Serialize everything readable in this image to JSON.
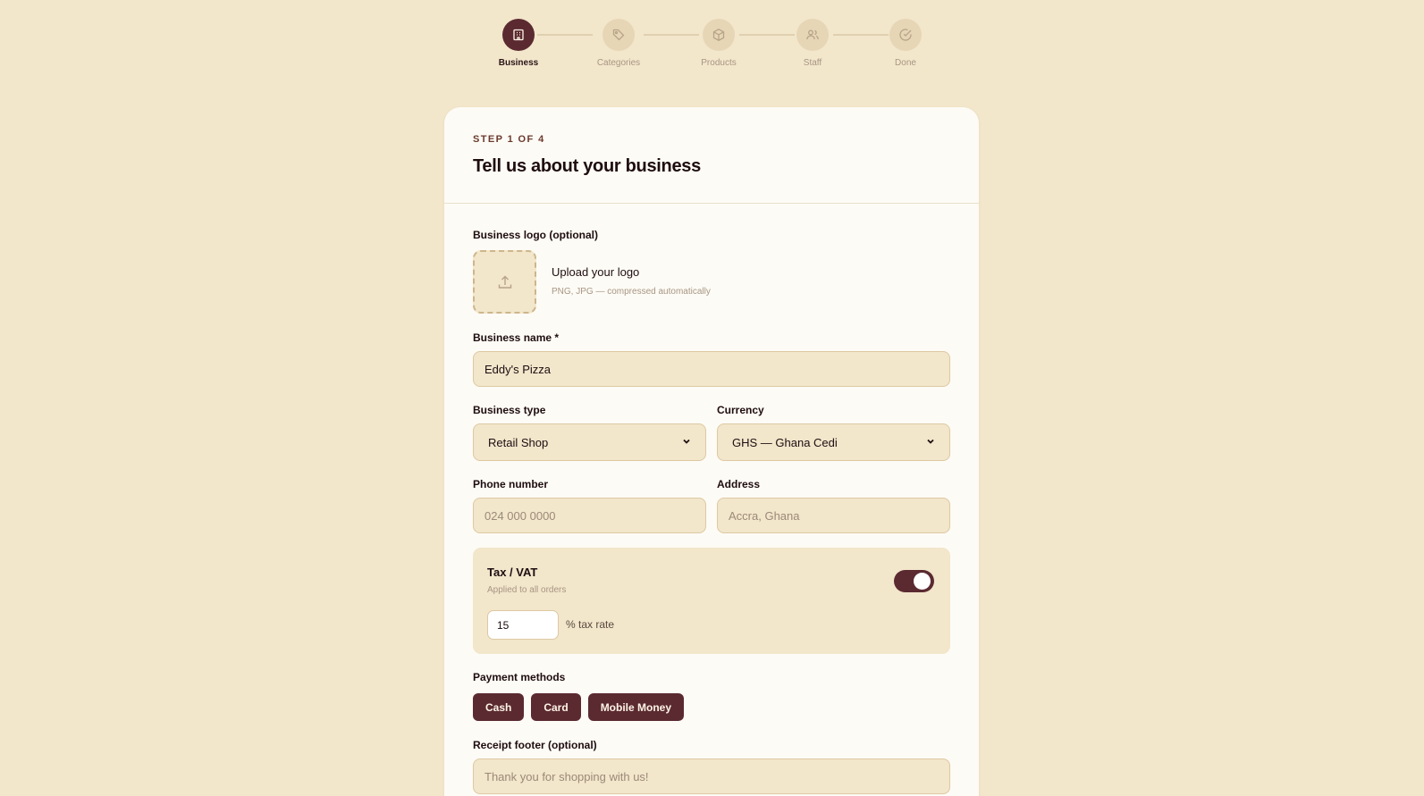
{
  "stepper": {
    "steps": [
      {
        "label": "Business",
        "icon": "building-icon",
        "state": "active"
      },
      {
        "label": "Categories",
        "icon": "tag-icon",
        "state": "pending"
      },
      {
        "label": "Products",
        "icon": "box-icon",
        "state": "pending"
      },
      {
        "label": "Staff",
        "icon": "users-icon",
        "state": "pending"
      },
      {
        "label": "Done",
        "icon": "check-circle-icon",
        "state": "pending"
      }
    ]
  },
  "card": {
    "step_indicator": "STEP 1 OF 4",
    "title": "Tell us about your business"
  },
  "logo": {
    "label": "Business logo (optional)",
    "upload_title": "Upload your logo",
    "upload_hint": "PNG, JPG — compressed automatically"
  },
  "business_name": {
    "label": "Business name *",
    "value": "Eddy's Pizza"
  },
  "business_type": {
    "label": "Business type",
    "selected": "Retail Shop"
  },
  "currency": {
    "label": "Currency",
    "selected": "GHS — Ghana Cedi"
  },
  "phone": {
    "label": "Phone number",
    "placeholder": "024 000 0000"
  },
  "address": {
    "label": "Address",
    "placeholder": "Accra, Ghana"
  },
  "tax": {
    "title": "Tax / VAT",
    "subtitle": "Applied to all orders",
    "enabled": true,
    "rate_value": "15",
    "rate_label": "% tax rate"
  },
  "payment_methods": {
    "label": "Payment methods",
    "options": [
      "Cash",
      "Card",
      "Mobile Money"
    ]
  },
  "receipt_footer": {
    "label": "Receipt footer (optional)",
    "placeholder": "Thank you for shopping with us!"
  },
  "colors": {
    "background": "#f2e6cb",
    "card": "#fdfbf5",
    "accent": "#5b2a31",
    "field": "#f2e6cb"
  }
}
